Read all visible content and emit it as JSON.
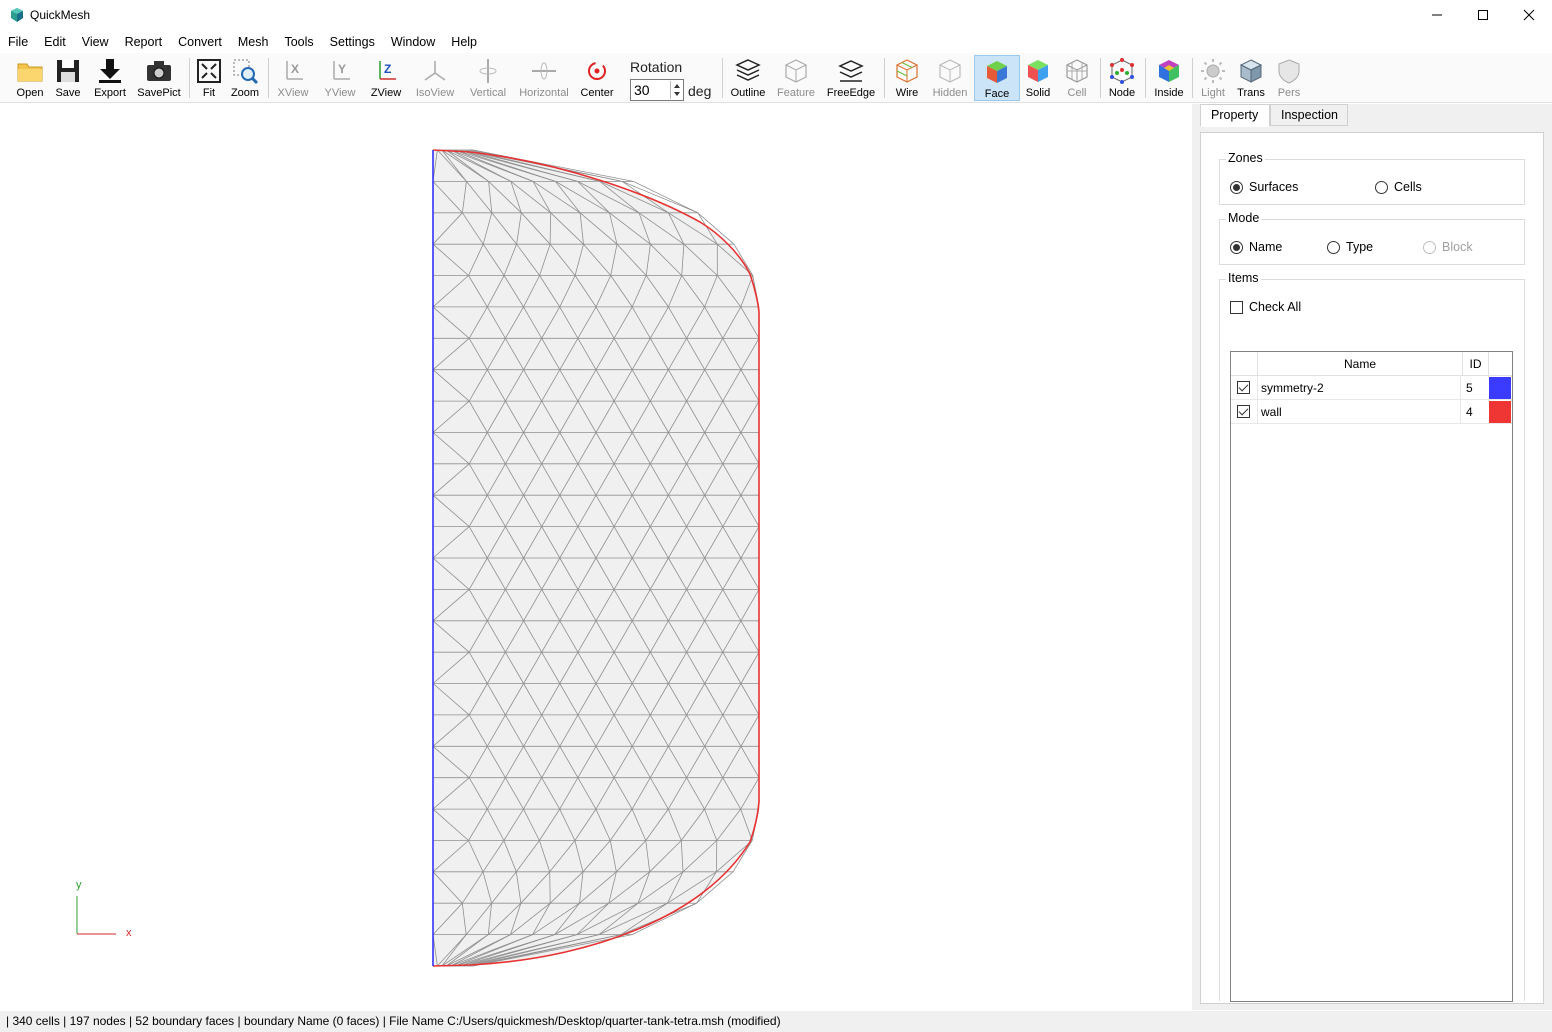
{
  "window": {
    "title": "QuickMesh",
    "minimize": "minimize-icon",
    "maximize": "maximize-icon",
    "close": "close-icon"
  },
  "menu": [
    "File",
    "Edit",
    "View",
    "Report",
    "Convert",
    "Mesh",
    "Tools",
    "Settings",
    "Window",
    "Help"
  ],
  "toolbar": {
    "open": "Open",
    "save": "Save",
    "export": "Export",
    "savepict": "SavePict",
    "fit": "Fit",
    "zoom": "Zoom",
    "xview": "XView",
    "yview": "YView",
    "zview": "ZView",
    "isoview": "IsoView",
    "vertical": "Vertical",
    "horizontal": "Horizontal",
    "center": "Center",
    "rotation_label": "Rotation",
    "rotation_value": "30",
    "rotation_unit": "deg",
    "outline": "Outline",
    "feature": "Feature",
    "freeedge": "FreeEdge",
    "wire": "Wire",
    "hidden": "Hidden",
    "face": "Face",
    "solid": "Solid",
    "cell": "Cell",
    "node": "Node",
    "inside": "Inside",
    "light": "Light",
    "trans": "Trans",
    "pers": "Pers"
  },
  "viewport": {
    "axis_y": "y",
    "axis_x": "x",
    "colors": {
      "symmetry": "#3232ff",
      "wall": "#e83232",
      "mesh_fill": "#f0f0f0",
      "mesh_line": "#909090"
    }
  },
  "panel": {
    "tabs": [
      "Property",
      "Inspection"
    ],
    "zones": {
      "title": "Zones",
      "surfaces": "Surfaces",
      "cells": "Cells"
    },
    "mode": {
      "title": "Mode",
      "name": "Name",
      "type": "Type",
      "block": "Block"
    },
    "items": {
      "title": "Items",
      "check_all": "Check All",
      "col_name": "Name",
      "col_id": "ID",
      "rows": [
        {
          "name": "symmetry-2",
          "id": "5",
          "color": "#3b3bff"
        },
        {
          "name": "wall",
          "id": "4",
          "color": "#f03535"
        }
      ]
    }
  },
  "status": "| 340 cells | 197 nodes | 52 boundary faces |  boundary Name  (0 faces) | File Name C:/Users/quickmesh/Desktop/quarter-tank-tetra.msh (modified)"
}
